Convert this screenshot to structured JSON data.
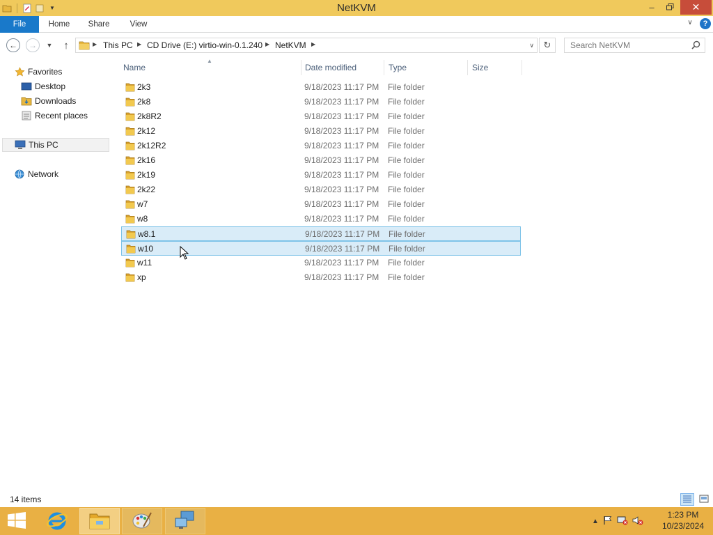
{
  "window": {
    "title": "NetKVM",
    "minimize_icon": "minimize-icon",
    "maximize_icon": "restore-icon",
    "close_icon": "close-icon"
  },
  "ribbon": {
    "tabs": [
      {
        "label": "File"
      },
      {
        "label": "Home"
      },
      {
        "label": "Share"
      },
      {
        "label": "View"
      }
    ]
  },
  "address": {
    "crumbs": [
      "This PC",
      "CD Drive (E:) virtio-win-0.1.240",
      "NetKVM"
    ]
  },
  "search": {
    "placeholder": "Search NetKVM"
  },
  "nav": {
    "favorites": {
      "label": "Favorites"
    },
    "items": [
      {
        "label": "Desktop"
      },
      {
        "label": "Downloads"
      },
      {
        "label": "Recent places"
      }
    ],
    "this_pc": {
      "label": "This PC"
    },
    "network": {
      "label": "Network"
    }
  },
  "columns": {
    "name": "Name",
    "date": "Date modified",
    "type": "Type",
    "size": "Size"
  },
  "files": [
    {
      "name": "2k3",
      "date": "9/18/2023 11:17 PM",
      "type": "File folder",
      "selected": false
    },
    {
      "name": "2k8",
      "date": "9/18/2023 11:17 PM",
      "type": "File folder",
      "selected": false
    },
    {
      "name": "2k8R2",
      "date": "9/18/2023 11:17 PM",
      "type": "File folder",
      "selected": false
    },
    {
      "name": "2k12",
      "date": "9/18/2023 11:17 PM",
      "type": "File folder",
      "selected": false
    },
    {
      "name": "2k12R2",
      "date": "9/18/2023 11:17 PM",
      "type": "File folder",
      "selected": false
    },
    {
      "name": "2k16",
      "date": "9/18/2023 11:17 PM",
      "type": "File folder",
      "selected": false
    },
    {
      "name": "2k19",
      "date": "9/18/2023 11:17 PM",
      "type": "File folder",
      "selected": false
    },
    {
      "name": "2k22",
      "date": "9/18/2023 11:17 PM",
      "type": "File folder",
      "selected": false
    },
    {
      "name": "w7",
      "date": "9/18/2023 11:17 PM",
      "type": "File folder",
      "selected": false
    },
    {
      "name": "w8",
      "date": "9/18/2023 11:17 PM",
      "type": "File folder",
      "selected": false
    },
    {
      "name": "w8.1",
      "date": "9/18/2023 11:17 PM",
      "type": "File folder",
      "selected": true
    },
    {
      "name": "w10",
      "date": "9/18/2023 11:17 PM",
      "type": "File folder",
      "selected": true
    },
    {
      "name": "w11",
      "date": "9/18/2023 11:17 PM",
      "type": "File folder",
      "selected": false
    },
    {
      "name": "xp",
      "date": "9/18/2023 11:17 PM",
      "type": "File folder",
      "selected": false
    }
  ],
  "status": {
    "count": "14 items"
  },
  "taskbar": {
    "time": "1:23 PM",
    "date": "10/23/2024"
  },
  "colors": {
    "title_bar": "#f0c95c",
    "taskbar": "#e9b044",
    "accent": "#1979ca",
    "selection": "#d9ecf8"
  }
}
